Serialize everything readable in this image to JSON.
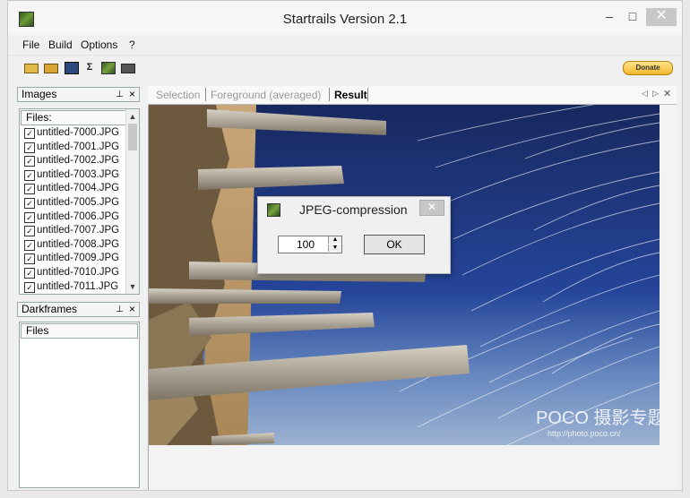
{
  "window": {
    "title": "Startrails Version 2.1",
    "controls": {
      "minimize": "–",
      "maximize": "□",
      "close": "✕"
    }
  },
  "menu": [
    "File",
    "Build",
    "Options",
    "?"
  ],
  "toolbar": {
    "icons": [
      "open-folder-icon",
      "open-files-icon",
      "save-icon",
      "sum-icon",
      "startrails-icon",
      "video-icon"
    ],
    "sum_glyph": "Σ",
    "donate_label": "Donate"
  },
  "images_panel": {
    "title": "Images",
    "pin": "ᵖ",
    "close": "×",
    "files_header": "Files:",
    "files": [
      "untitled-7000.JPG",
      "untitled-7001.JPG",
      "untitled-7002.JPG",
      "untitled-7003.JPG",
      "untitled-7004.JPG",
      "untitled-7005.JPG",
      "untitled-7006.JPG",
      "untitled-7007.JPG",
      "untitled-7008.JPG",
      "untitled-7009.JPG",
      "untitled-7010.JPG",
      "untitled-7011.JPG"
    ]
  },
  "darkframes_panel": {
    "title": "Darkframes",
    "pin": "ᵖ",
    "close": "×",
    "files_header": "Files"
  },
  "tabs": [
    {
      "label": "Selection",
      "active": false
    },
    {
      "label": "Foreground (averaged)",
      "active": false
    },
    {
      "label": "Result",
      "active": true
    }
  ],
  "watermark": {
    "brand": "POCO 摄影专题",
    "url": "http://photo.poco.cn/"
  },
  "dialog": {
    "title": "JPEG-compression",
    "close": "✕",
    "value": "100",
    "ok_label": "OK"
  },
  "colors": {
    "accent": "#f2b52a",
    "sky_top": "#17285e",
    "sky_mid": "#25459a"
  }
}
